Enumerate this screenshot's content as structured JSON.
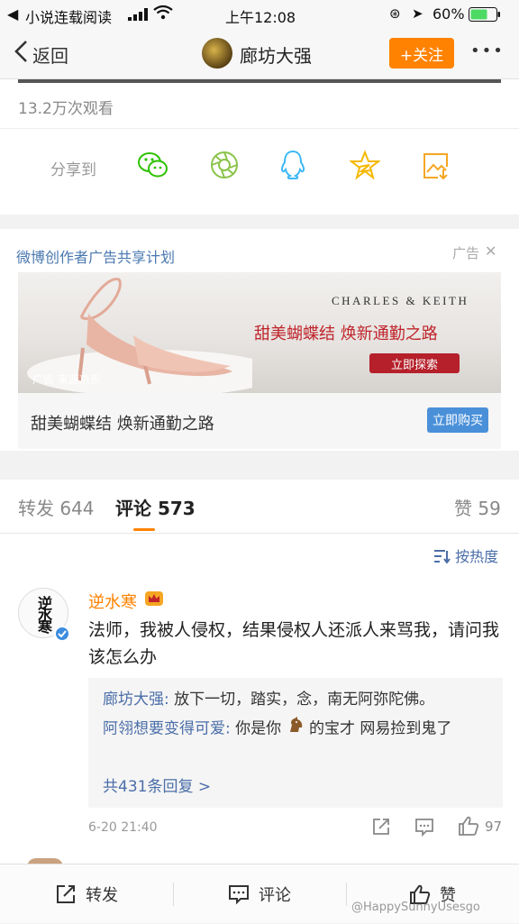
{
  "status_bar": {
    "app_back_label": "小说连载阅读",
    "time": "上午12:08",
    "battery": "60%"
  },
  "nav": {
    "back_label": "返回",
    "title": "廊坊大强",
    "follow_label": "+关注",
    "more_label": "•••"
  },
  "post": {
    "views": "13.2万次观看",
    "share_label": "分享到",
    "share_targets": [
      "wechat-icon",
      "moments-icon",
      "qq-icon",
      "qzone-icon",
      "save-image-icon"
    ]
  },
  "ad": {
    "header_title": "微博创作者广告共享计划",
    "ad_tag": "广告",
    "close_glyph": "✕",
    "brand": "CHARLES & KEITH",
    "banner_headline": "甜美蝴蝶结 焕新通勤之路",
    "banner_button": "立即探索",
    "source": "广告 来源京东",
    "caption": "甜美蝴蝶结 焕新通勤之路",
    "buy_button": "立即购买"
  },
  "tabs": {
    "repost_label": "转发",
    "repost_count": "644",
    "comment_label": "评论",
    "comment_count": "573",
    "like_label": "赞",
    "like_count": "59"
  },
  "sort": {
    "label": "按热度"
  },
  "comment": {
    "avatar_text": "逆水寒",
    "username": "逆水寒",
    "text": "法师，我被人侵权，结果侵权人还派人来骂我，请问我该怎么办",
    "replies": [
      {
        "user": "廊坊大强",
        "text": "放下一切，踏实，念，南无阿弥陀佛。"
      },
      {
        "user": "阿翎想要变得可爱",
        "text_before": "你是你",
        "text_after": "的宝才 网易捡到鬼了"
      }
    ],
    "more_replies": "共431条回复 >",
    "timestamp": "6-20 21:40",
    "like_count": "97"
  },
  "bottom_bar": {
    "repost_label": "转发",
    "comment_label": "评论",
    "like_label": "赞",
    "watermark": "@HappySunnyUsesgo"
  },
  "colors": {
    "accent_orange": "#ff8200",
    "link_blue": "#4b6ea8",
    "ad_blue": "#4a90d9",
    "banner_red": "#c0242b"
  }
}
